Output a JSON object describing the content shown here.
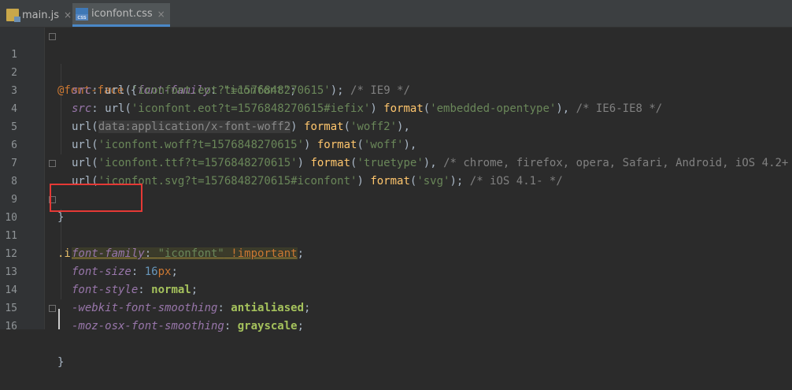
{
  "tabs": [
    {
      "label": "main.js",
      "icon": "js-file-icon",
      "active": false
    },
    {
      "label": "iconfont.css",
      "icon": "css-file-icon",
      "active": true
    }
  ],
  "close_glyph": "×",
  "lines": [
    {
      "n": "1"
    },
    {
      "n": "2"
    },
    {
      "n": "3"
    },
    {
      "n": "4"
    },
    {
      "n": "5"
    },
    {
      "n": "6"
    },
    {
      "n": "7"
    },
    {
      "n": "8"
    },
    {
      "n": "9"
    },
    {
      "n": "10"
    },
    {
      "n": "11"
    },
    {
      "n": "12"
    },
    {
      "n": "13"
    },
    {
      "n": "14"
    },
    {
      "n": "15"
    },
    {
      "n": "16"
    }
  ],
  "code": {
    "l1": {
      "at": "@font-face",
      "brace": " {",
      "prop": "font-family",
      "colon": ": ",
      "str": "\"iconfont\"",
      "end": ";"
    },
    "l2": {
      "prop": "src",
      "pre": ": url(",
      "str": "'iconfont.eot?t=1576848270615'",
      "post": "); ",
      "cmt": "/* IE9 */"
    },
    "l3": {
      "prop": "src",
      "pre": ": url(",
      "str": "'iconfont.eot?t=1576848270615#iefix'",
      "mid": ") ",
      "fn": "format",
      "open": "(",
      "str2": "'embedded-opentype'",
      "post": "), ",
      "cmt": "/* IE6-IE8 */"
    },
    "l4": {
      "pre": "url(",
      "data": "data:application/x-font-woff2",
      "mid": ") ",
      "fn": "format",
      "open": "(",
      "str2": "'woff2'",
      "post": "),"
    },
    "l5": {
      "pre": "url(",
      "str": "'iconfont.woff?t=1576848270615'",
      "mid": ") ",
      "fn": "format",
      "open": "(",
      "str2": "'woff'",
      "post": "),"
    },
    "l6": {
      "pre": "url(",
      "str": "'iconfont.ttf?t=1576848270615'",
      "mid": ") ",
      "fn": "format",
      "open": "(",
      "str2": "'truetype'",
      "post": "), ",
      "cmt": "/* chrome, firefox, opera, Safari, Android, iOS 4.2+ */"
    },
    "l7": {
      "pre": "url(",
      "str": "'iconfont.svg?t=1576848270615#iconfont'",
      "mid": ") ",
      "fn": "format",
      "open": "(",
      "str2": "'svg'",
      "post": "); ",
      "cmt": "/* iOS 4.1- */"
    },
    "l8": {
      "text": "}"
    },
    "l10": {
      "sel": ".iconfont",
      "brace": " {"
    },
    "l11": {
      "prop": "font-family",
      "colon": ": ",
      "str": "\"iconfont\"",
      "kw": " !important",
      "end": ";"
    },
    "l12": {
      "prop": "font-size",
      "colon": ": ",
      "num": "16",
      "unit": "px",
      "end": ";"
    },
    "l13": {
      "prop": "font-style",
      "colon": ": ",
      "val": "normal",
      "end": ";"
    },
    "l14": {
      "prop": "-webkit-font-smoothing",
      "colon": ": ",
      "val": "antialiased",
      "end": ";"
    },
    "l15": {
      "prop": "-moz-osx-font-smoothing",
      "colon": ": ",
      "val": "grayscale",
      "end": ";"
    },
    "l16": {
      "text": "}"
    }
  },
  "colors": {
    "background": "#2b2b2b",
    "highlight_box": "#e53935"
  }
}
